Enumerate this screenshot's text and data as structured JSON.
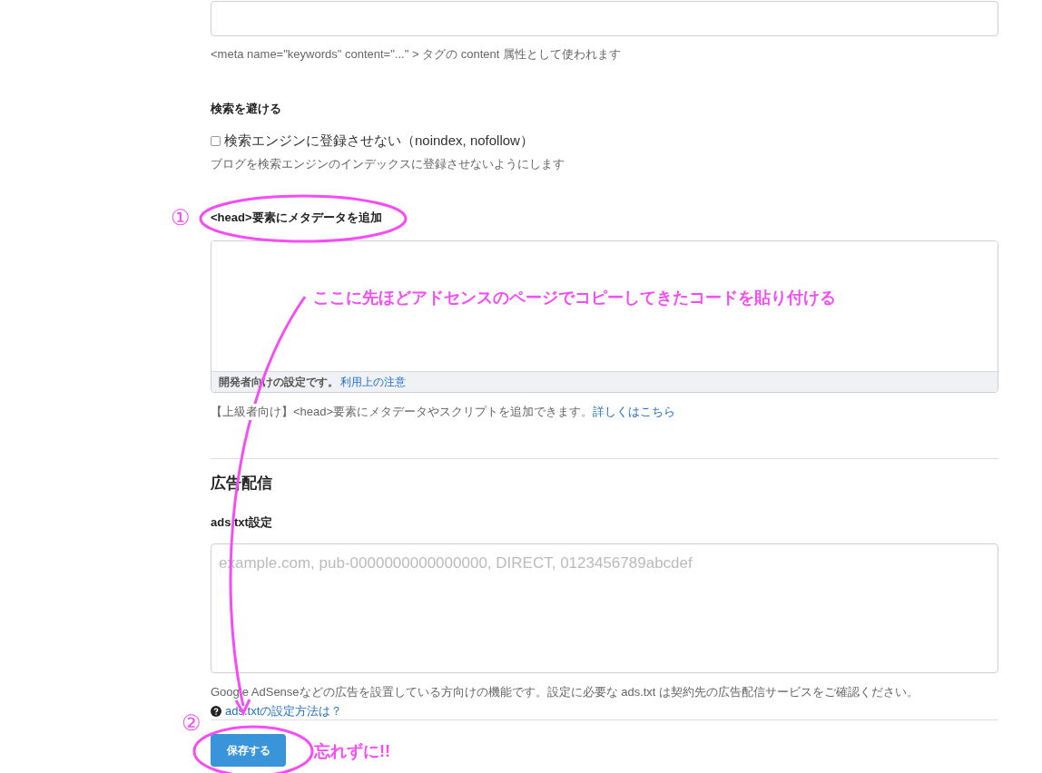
{
  "keywords": {
    "hint": "<meta name=\"keywords\" content=\"...\" > タグの content 属性として使われます"
  },
  "noindex": {
    "heading": "検索を避ける",
    "checkbox_label": "検索エンジンに登録させない（noindex, nofollow）",
    "checked": false,
    "hint": "ブログを検索エンジンのインデックスに登録させないようにします"
  },
  "head_meta": {
    "heading": "<head>要素にメタデータを追加",
    "footer_text": "開発者向けの設定です。",
    "footer_link": "利用上の注意",
    "hint": "【上級者向け】<head>要素にメタデータやスクリプトを追加できます。",
    "hint_link": "詳しくはこちら"
  },
  "ads": {
    "section_title": "広告配信",
    "heading": "ads.txt設定",
    "placeholder": "example.com, pub-0000000000000000, DIRECT, 0123456789abcdef",
    "hint": "Google AdSenseなどの広告を設置している方向けの機能です。設定に必要な ads.txt は契約先の広告配信サービスをご確認ください。",
    "help_link": "ads.txtの設定方法は？"
  },
  "save_button": "保存する",
  "annotations": {
    "marker_1": "①",
    "marker_2": "②",
    "instruction": "ここに先ほどアドセンスのページでコピーしてきたコードを貼り付ける",
    "reminder": "忘れずに!!"
  }
}
